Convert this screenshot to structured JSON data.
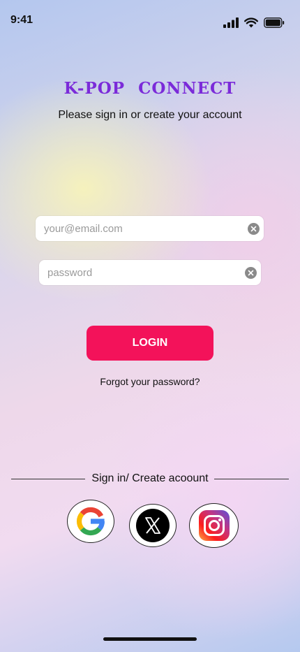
{
  "status_bar": {
    "time": "9:41"
  },
  "header": {
    "title": "K-POP  CONNECT",
    "subtitle": "Please sign in or create your account"
  },
  "form": {
    "email_placeholder": "your@email.com",
    "password_placeholder": "password",
    "login_label": "LOGIN",
    "forgot_label": "Forgot your password?"
  },
  "social": {
    "divider_label": "Sign in/ Create acoount",
    "providers": [
      "google-icon",
      "x-icon",
      "instagram-icon"
    ]
  },
  "colors": {
    "title": "#7b2bd9",
    "login_button": "#f3125a"
  }
}
